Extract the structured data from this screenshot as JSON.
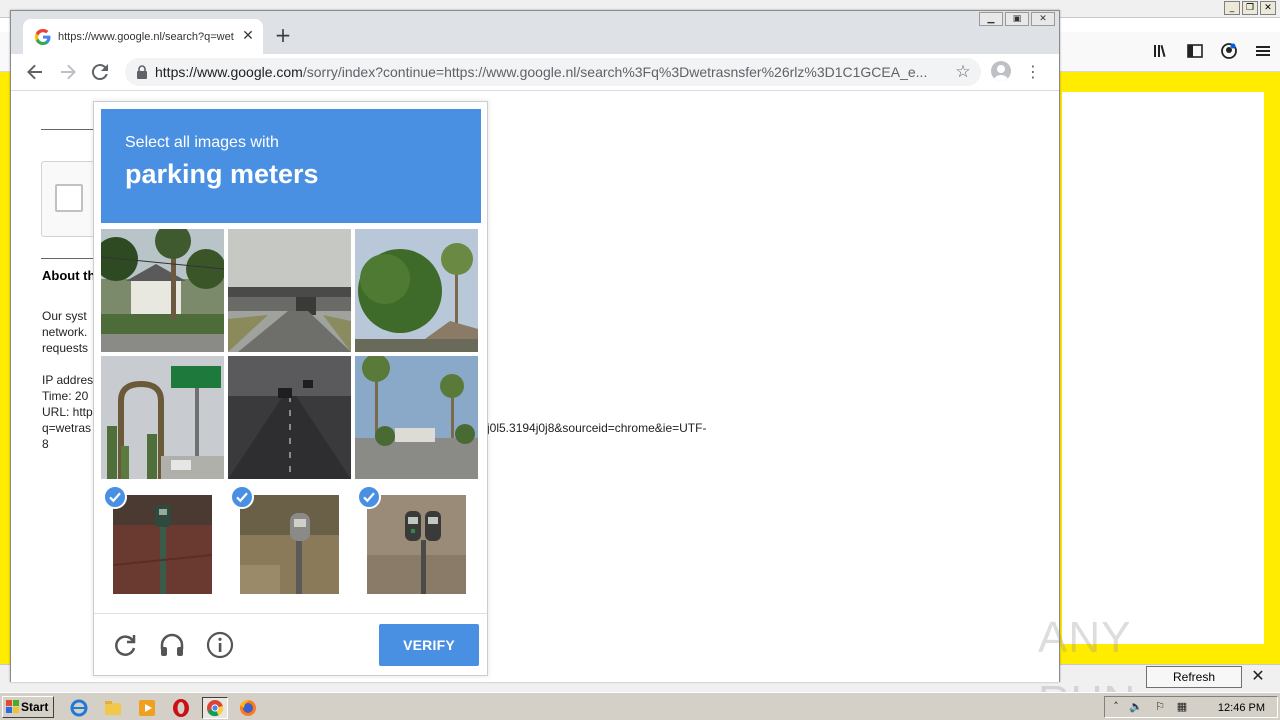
{
  "firefox": {
    "notification_button": "Refresh Firefox…",
    "content_color": "#ffec00"
  },
  "chrome": {
    "tab_title": "https://www.google.nl/search?q=wetrasnsfer",
    "url_host": "https://www.google.com",
    "url_path": "/sorry/index?continue=https://www.google.nl/search%3Fq%3Dwetrasnsfer%26rlz%3D1C1GCEA_e..."
  },
  "page": {
    "about_heading": "About th",
    "para_line1": "Our syst",
    "para_line2": "network.",
    "para_line3": "requests",
    "ip_label": "IP addres",
    "time_label": "Time: 20",
    "url_label": "URL: http",
    "url_line2": "q=wetras",
    "url_tail": "j0l5.3194j0j8&sourceid=chrome&ie=UTF-",
    "url_line3": "8"
  },
  "captcha": {
    "instruction": "Select all images with",
    "target": "parking meters",
    "verify_label": "VERIFY",
    "accent_color": "#4a90e2",
    "tiles": [
      {
        "scene": "house-with-palms",
        "selected": false
      },
      {
        "scene": "highway-overpass",
        "selected": false
      },
      {
        "scene": "tree-and-palm",
        "selected": false
      },
      {
        "scene": "cactus-and-street-sign",
        "selected": false
      },
      {
        "scene": "road-tunnel",
        "selected": false
      },
      {
        "scene": "palm-street",
        "selected": false
      },
      {
        "scene": "parking-meter",
        "selected": true
      },
      {
        "scene": "parking-meter",
        "selected": true
      },
      {
        "scene": "double-parking-meter",
        "selected": true
      }
    ],
    "footer_icons": [
      "reload-icon",
      "headphones-icon",
      "info-icon"
    ]
  },
  "watermark": "ANY RUN",
  "taskbar": {
    "start_label": "Start",
    "clock": "12:46 PM"
  }
}
